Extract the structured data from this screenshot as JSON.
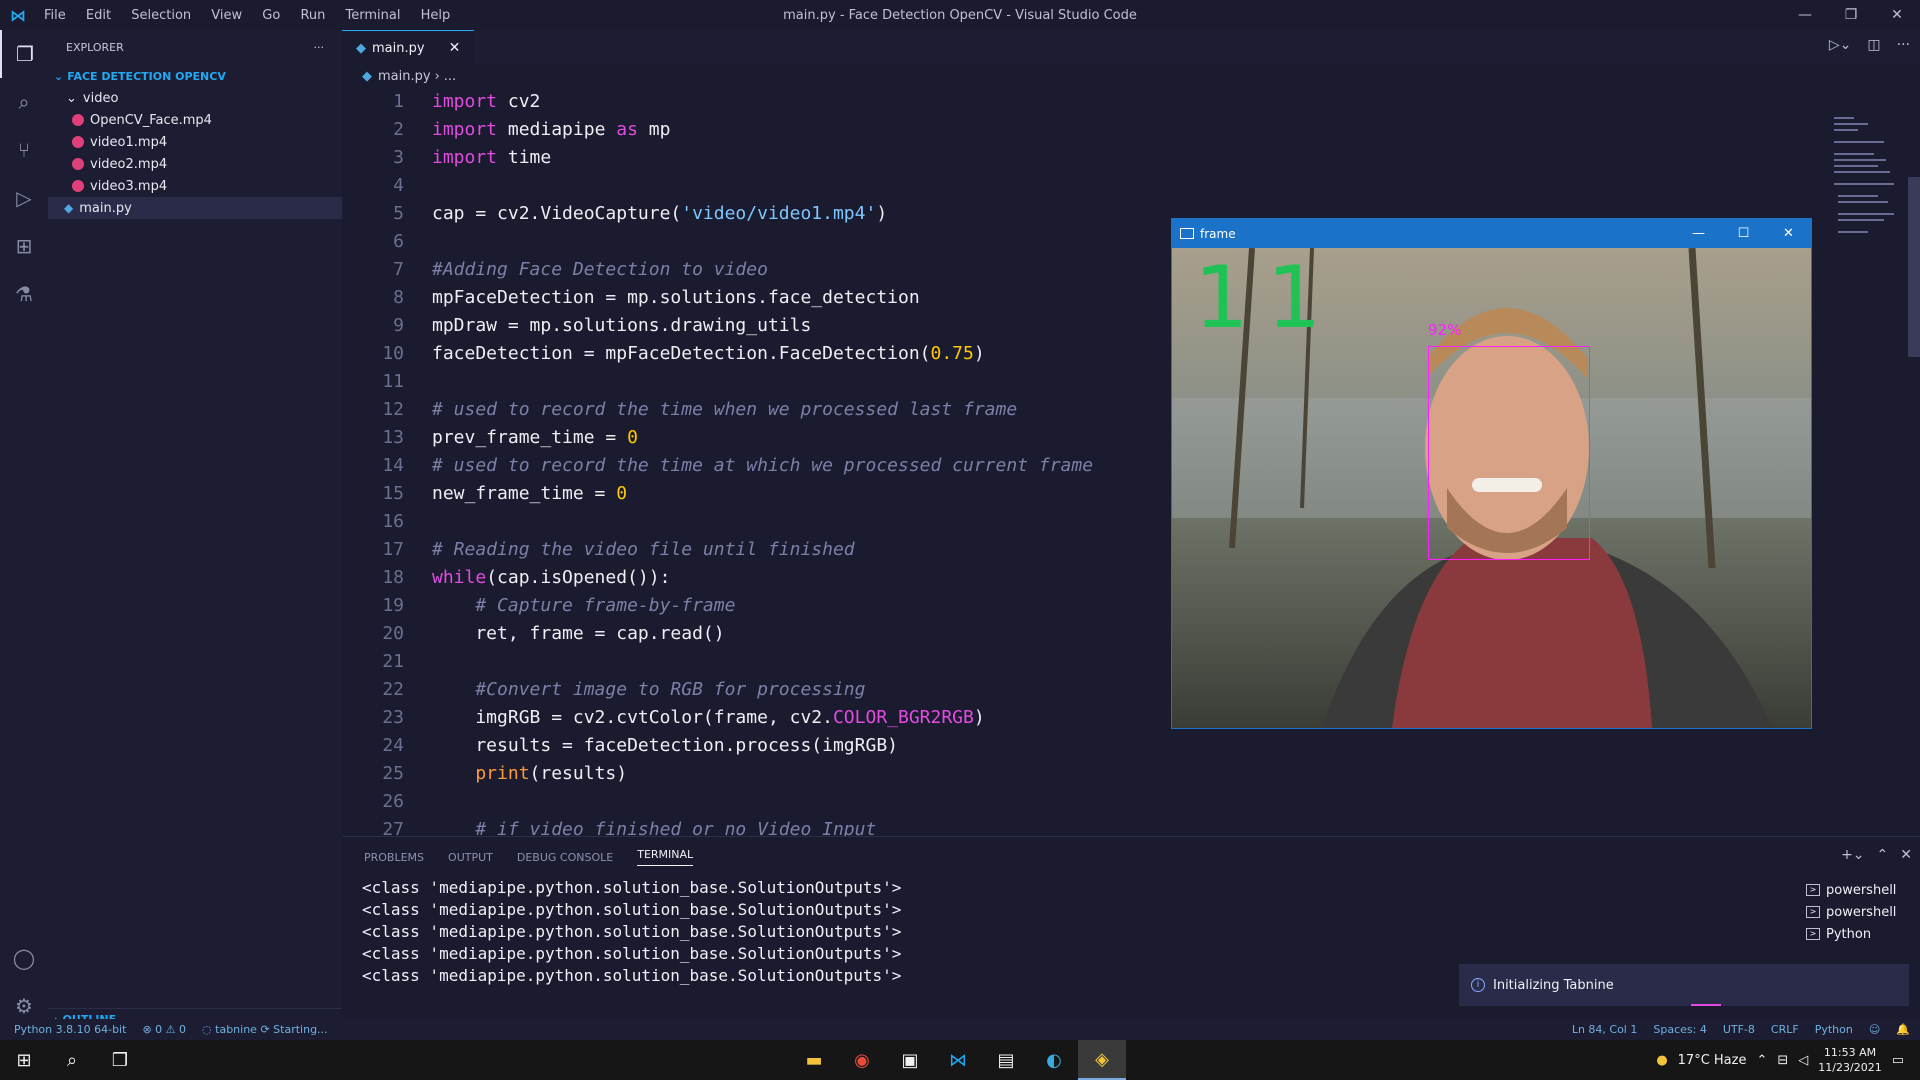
{
  "window": {
    "title": "main.py - Face Detection OpenCV - Visual Studio Code",
    "menu": [
      "File",
      "Edit",
      "Selection",
      "View",
      "Go",
      "Run",
      "Terminal",
      "Help"
    ]
  },
  "explorer": {
    "header": "EXPLORER",
    "folder": "FACE DETECTION OPENCV",
    "subfolder": "video",
    "files": [
      "OpenCV_Face.mp4",
      "video1.mp4",
      "video2.mp4",
      "video3.mp4"
    ],
    "root_file": "main.py",
    "outline": "OUTLINE"
  },
  "editor": {
    "tab": "main.py",
    "breadcrumb_file": "main.py",
    "breadcrumb_rest": "...",
    "line_numbers": [
      "1",
      "2",
      "3",
      "4",
      "5",
      "6",
      "7",
      "8",
      "9",
      "10",
      "11",
      "12",
      "13",
      "14",
      "15",
      "16",
      "17",
      "18",
      "19",
      "20",
      "21",
      "22",
      "23",
      "24",
      "25",
      "26",
      "27"
    ]
  },
  "code": {
    "l1_kw": "import",
    "l1_rest": " cv2",
    "l2_kw": "import",
    "l2_mid": " mediapipe ",
    "l2_kw2": "as",
    "l2_rest": " mp",
    "l3_kw": "import",
    "l3_rest": " time",
    "l5_a": "cap = cv2.VideoCapture(",
    "l5_str": "'video/video1.mp4'",
    "l5_b": ")",
    "l7": "#Adding Face Detection to video",
    "l8": "mpFaceDetection = mp.solutions.face_detection",
    "l9": "mpDraw = mp.solutions.drawing_utils",
    "l10_a": "faceDetection = mpFaceDetection.FaceDetection(",
    "l10_num": "0.75",
    "l10_b": ")",
    "l12": "# used to record the time when we processed last frame",
    "l13_a": "prev_frame_time = ",
    "l13_num": "0",
    "l14": "# used to record the time at which we processed current frame",
    "l15_a": "new_frame_time = ",
    "l15_num": "0",
    "l17": "# Reading the video file until finished",
    "l18_kw": "while",
    "l18_rest": "(cap.isOpened()):",
    "l19": "    # Capture frame-by-frame",
    "l20": "    ret, frame = cap.read()",
    "l22": "    #Convert image to RGB for processing",
    "l23_a": "    imgRGB = cv2.cvtColor(frame, cv2.",
    "l23_const": "COLOR_BGR2RGB",
    "l23_b": ")",
    "l24": "    results = faceDetection.process(imgRGB)",
    "l25_fn": "    print",
    "l25_rest": "(results)",
    "l27": "    # if video finished or no Video Input"
  },
  "panel": {
    "tabs": [
      "PROBLEMS",
      "OUTPUT",
      "DEBUG CONSOLE",
      "TERMINAL"
    ],
    "terminal_lines": [
      "<class 'mediapipe.python.solution_base.SolutionOutputs'>",
      "<class 'mediapipe.python.solution_base.SolutionOutputs'>",
      "<class 'mediapipe.python.solution_base.SolutionOutputs'>",
      "<class 'mediapipe.python.solution_base.SolutionOutputs'>",
      "<class 'mediapipe.python.solution_base.SolutionOutputs'>"
    ],
    "terminals": [
      "powershell",
      "powershell",
      "Python"
    ]
  },
  "toast": {
    "message": "Initializing Tabnine"
  },
  "frame_window": {
    "title": "frame",
    "fps": "11",
    "confidence": "92%"
  },
  "status": {
    "python": "Python 3.8.10 64-bit",
    "errors": "0",
    "warnings": "0",
    "tabnine": "tabnine",
    "starting": "Starting...",
    "position": "Ln 84, Col 1",
    "spaces": "Spaces: 4",
    "encoding": "UTF-8",
    "eol": "CRLF",
    "language": "Python"
  },
  "taskbar": {
    "weather": "17°C Haze",
    "time": "11:53 AM",
    "date": "11/23/2021"
  },
  "colors": {
    "accent": "#23a9f2",
    "keyword": "#e34be0",
    "number": "#ffc800",
    "string": "#7ec6ff",
    "fps_text": "#1fc254",
    "detection_box": "#ff20ff"
  }
}
